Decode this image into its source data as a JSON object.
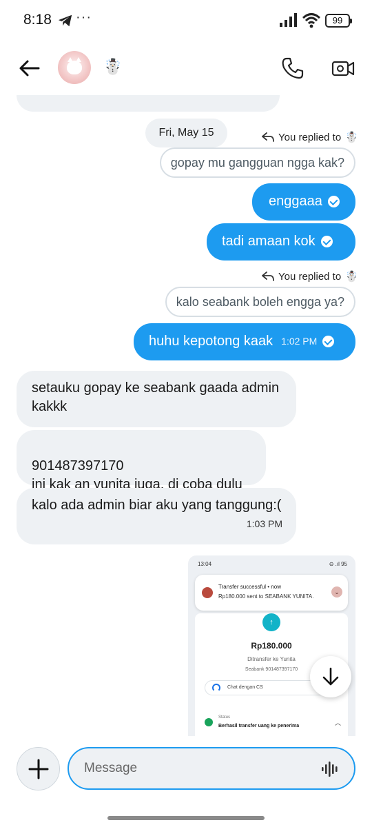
{
  "status_bar": {
    "time": "8:18",
    "dots": "···",
    "battery": "99"
  },
  "header": {
    "contact_emoji": "☃️",
    "icons": [
      "back-arrow-icon",
      "avatar",
      "phone-icon",
      "video-camera-icon"
    ]
  },
  "chat": {
    "top_partial_message": "...",
    "date_separator": "Fri, May 15",
    "replied_label": "You replied to",
    "replied_emoji": "☃️",
    "messages": [
      {
        "type": "reply_ref",
        "text": "gopay mu gangguan ngga kak?"
      },
      {
        "type": "outgoing",
        "text": "enggaaa",
        "read": true
      },
      {
        "type": "outgoing",
        "text": "tadi amaan kok",
        "read": true
      },
      {
        "type": "reply_ref",
        "text": "kalo seabank boleh engga ya?"
      },
      {
        "type": "outgoing",
        "text": "huhu kepotong kaak",
        "time": "1:02 PM",
        "read": true
      },
      {
        "type": "incoming",
        "text": "setauku gopay ke seabank gaada admin kakkk"
      },
      {
        "type": "incoming",
        "text": "901487397170\nini kak an yunita juga, di coba dulu"
      },
      {
        "type": "incoming",
        "text": "kalo ada admin biar aku yang tanggung:(",
        "time": "1:03 PM"
      }
    ],
    "image_message": {
      "status_time": "13:04",
      "status_right": "⊖ .ıl 95",
      "notif_title": "Transfer successful • now",
      "notif_body": "Rp180.000 sent to SEABANK YUNITA.",
      "amount": "Rp180.000",
      "sub1": "Ditransfer ke Yunita",
      "sub2": "Seabank 901487397170",
      "cs_label": "Chat dengan CS",
      "status_label": "Status",
      "status_value": "Berhasil transfer uang ke penerima"
    }
  },
  "composer": {
    "placeholder": "Message"
  },
  "colors": {
    "accent": "#1d9bf0",
    "incoming_bg": "#eef1f4"
  }
}
